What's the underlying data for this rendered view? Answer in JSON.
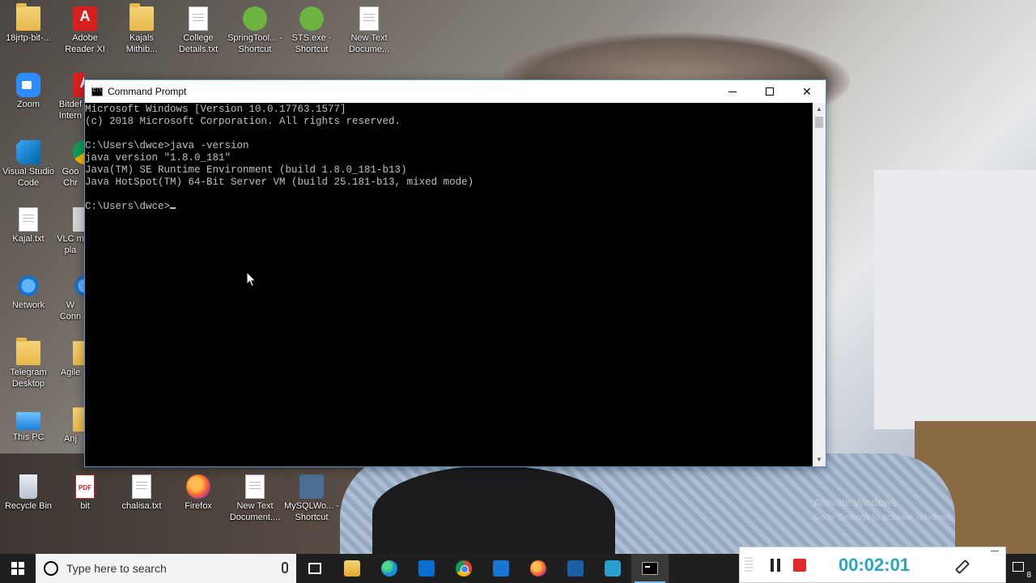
{
  "desktop": {
    "icons": [
      {
        "id": "18jrtp",
        "label": "18jrtp-bit-...",
        "icon": "folder-icon"
      },
      {
        "id": "adobe",
        "label": "Adobe Reader XI",
        "icon": "adobe-reader-icon"
      },
      {
        "id": "kajals",
        "label": "Kajals Mithib...",
        "icon": "folder-icon"
      },
      {
        "id": "college",
        "label": "College Details.txt",
        "icon": "text-file-icon"
      },
      {
        "id": "springtool",
        "label": "SpringTool... - Shortcut",
        "icon": "spring-icon"
      },
      {
        "id": "sts",
        "label": "STS.exe - Shortcut",
        "icon": "spring-icon"
      },
      {
        "id": "newtext1",
        "label": "New Text Docume...",
        "icon": "text-file-icon"
      },
      {
        "id": "zoom",
        "label": "Zoom",
        "icon": "zoom-icon"
      },
      {
        "id": "bitdefender",
        "label": "Bitdef Intern",
        "icon": "bitdefender-icon"
      },
      {
        "id": "vscode",
        "label": "Visual Studio Code",
        "icon": "vscode-icon"
      },
      {
        "id": "chrome",
        "label": "Goo Chr",
        "icon": "chrome-icon"
      },
      {
        "id": "kajaltxt",
        "label": "Kajal.txt",
        "icon": "text-file-icon"
      },
      {
        "id": "vlc",
        "label": "VLC m pla",
        "icon": "vlc-icon"
      },
      {
        "id": "network",
        "label": "Network",
        "icon": "network-icon"
      },
      {
        "id": "wconn",
        "label": "W Conn",
        "icon": "connect-icon"
      },
      {
        "id": "telegram",
        "label": "Telegram Desktop",
        "icon": "folder-icon"
      },
      {
        "id": "agile",
        "label": "Agile",
        "icon": "folder-icon"
      },
      {
        "id": "thispc",
        "label": "This PC",
        "icon": "computer-icon"
      },
      {
        "id": "anj",
        "label": "Anj",
        "icon": "folder-icon"
      },
      {
        "id": "recycle",
        "label": "Recycle Bin",
        "icon": "recycle-bin-icon"
      },
      {
        "id": "bit",
        "label": "bit",
        "icon": "pdf-file-icon"
      },
      {
        "id": "chalisa",
        "label": "chalisa.txt",
        "icon": "text-file-icon"
      },
      {
        "id": "firefox",
        "label": "Firefox",
        "icon": "firefox-icon"
      },
      {
        "id": "newtext2",
        "label": "New Text Document....",
        "icon": "text-file-icon"
      },
      {
        "id": "mysql",
        "label": "MySQLWo... - Shortcut",
        "icon": "mysql-icon"
      }
    ]
  },
  "cmd_window": {
    "title": "Command Prompt",
    "minimize_label": "—",
    "maximize_label": "☐",
    "close_label": "✕",
    "lines": [
      "Microsoft Windows [Version 10.0.17763.1577]",
      "(c) 2018 Microsoft Corporation. All rights reserved.",
      "",
      "C:\\Users\\dwce>java -version",
      "java version \"1.8.0_181\"",
      "Java(TM) SE Runtime Environment (build 1.8.0_181-b13)",
      "Java HotSpot(TM) 64-Bit Server VM (build 25.181-b13, mixed mode)",
      "",
      "C:\\Users\\dwce>"
    ]
  },
  "watermark": {
    "line1": "Activate Windows",
    "line2": "Go to Settings to activate Windows."
  },
  "taskbar": {
    "search_placeholder": "Type here to search",
    "apps": [
      {
        "id": "taskview",
        "icon": "task-view-icon",
        "active": false
      },
      {
        "id": "explorer",
        "icon": "file-explorer-icon",
        "active": false
      },
      {
        "id": "edge",
        "icon": "edge-icon",
        "active": false
      },
      {
        "id": "mail",
        "icon": "mail-icon",
        "active": false
      },
      {
        "id": "chrome",
        "icon": "chrome-icon",
        "active": false
      },
      {
        "id": "store",
        "icon": "store-icon",
        "active": false
      },
      {
        "id": "firefox",
        "icon": "firefox-icon",
        "active": false
      },
      {
        "id": "photos",
        "icon": "photos-icon",
        "active": false
      },
      {
        "id": "camera",
        "icon": "camera-icon",
        "active": false
      },
      {
        "id": "cmd",
        "icon": "command-prompt-icon",
        "active": true
      }
    ],
    "notification_count": "8"
  },
  "recorder": {
    "elapsed": "00:02:01"
  },
  "colors": {
    "accent": "#2ba6b8",
    "stop": "#e02a2a",
    "console_bg": "#000000",
    "console_text": "#c0c0c0"
  }
}
